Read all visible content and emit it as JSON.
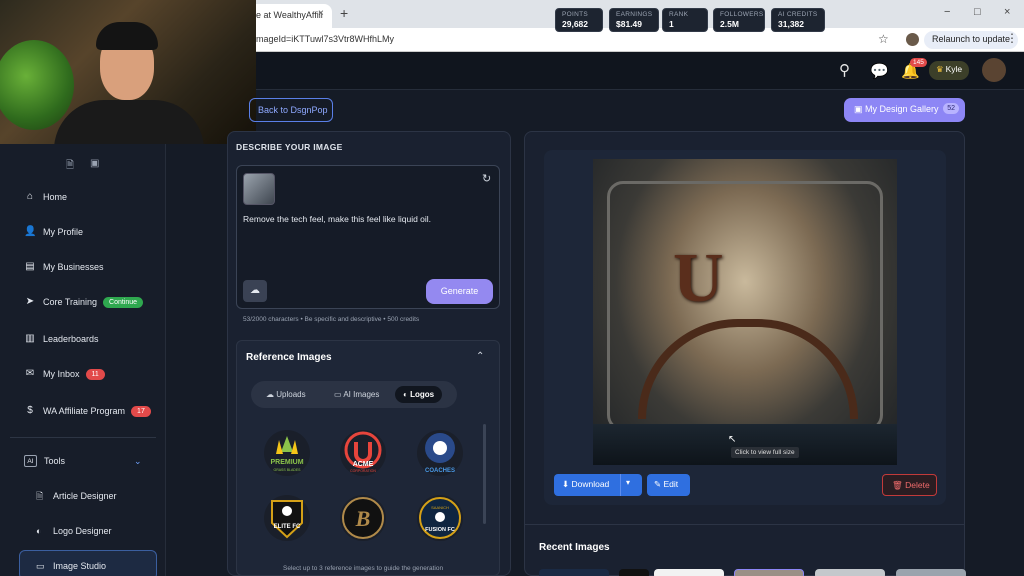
{
  "browser": {
    "tab_title": "e at WealthyAffili",
    "tab_close": "×",
    "new_tab": "+",
    "url": "mageId=iKTTuwl7s3Vtr8WHfhLMy",
    "relaunch_label": "Relaunch to update",
    "window_controls": [
      "−",
      "□",
      "×"
    ]
  },
  "header": {
    "stats": [
      {
        "label": "POINTS",
        "value": "29,682"
      },
      {
        "label": "EARNINGS",
        "value": "$81.49"
      },
      {
        "label": "RANK",
        "value": "1"
      },
      {
        "label": "FOLLOWERS",
        "value": "2.5M"
      },
      {
        "label": "AI CREDITS",
        "value": "31,382"
      }
    ],
    "notification_count": "145",
    "user_name": "Kyle"
  },
  "sidebar": {
    "items": [
      {
        "label": "Home",
        "icon": "home-icon"
      },
      {
        "label": "My Profile",
        "icon": "user-icon"
      },
      {
        "label": "My Businesses",
        "icon": "business-icon"
      },
      {
        "label": "Core Training",
        "icon": "training-icon",
        "badge": "Continue"
      },
      {
        "label": "Leaderboards",
        "icon": "leaderboard-icon"
      },
      {
        "label": "My Inbox",
        "icon": "mail-icon",
        "badge": "11"
      },
      {
        "label": "WA Affiliate Program",
        "icon": "dollar-icon",
        "badge": "17"
      }
    ],
    "tools_label": "Tools",
    "tools_icon_text": "AI",
    "subitems": [
      {
        "label": "Article Designer"
      },
      {
        "label": "Logo Designer"
      },
      {
        "label": "Image Studio"
      }
    ]
  },
  "main": {
    "back_label": "Back to DsgnPop",
    "gallery_label": "My Design Gallery",
    "gallery_count": "52",
    "describe_title": "DESCRIBE YOUR IMAGE",
    "prompt_text": "Remove the tech feel, make this feel like liquid oil.",
    "generate_label": "Generate",
    "char_info": "53/2000 characters • Be specific and descriptive • 500 credits",
    "reference": {
      "title": "Reference Images",
      "tabs": [
        "Uploads",
        "AI Images",
        "Logos"
      ],
      "active_tab": "Logos",
      "logos": [
        {
          "text": "PREMIUM",
          "sub": "GRASS BLADES",
          "color": "#8bc34a"
        },
        {
          "text": "ACME",
          "sub": "CORPORATION",
          "color": "#e8453c"
        },
        {
          "text": "COACHES",
          "sub": "",
          "color": "#4a7fd6"
        },
        {
          "text": "ELITE FC",
          "sub": "",
          "color": "#d4a017"
        },
        {
          "text": "B",
          "sub": "",
          "color": "#b08a4a"
        },
        {
          "text": "FUSION FC",
          "sub": "SAANICH",
          "color": "#d4a017"
        }
      ],
      "hint": "Select up to 3 reference images to guide the generation"
    },
    "preview": {
      "tooltip": "Click to view full size",
      "download_label": "Download",
      "edit_label": "Edit",
      "delete_label": "Delete"
    },
    "recent_title": "Recent Images"
  }
}
